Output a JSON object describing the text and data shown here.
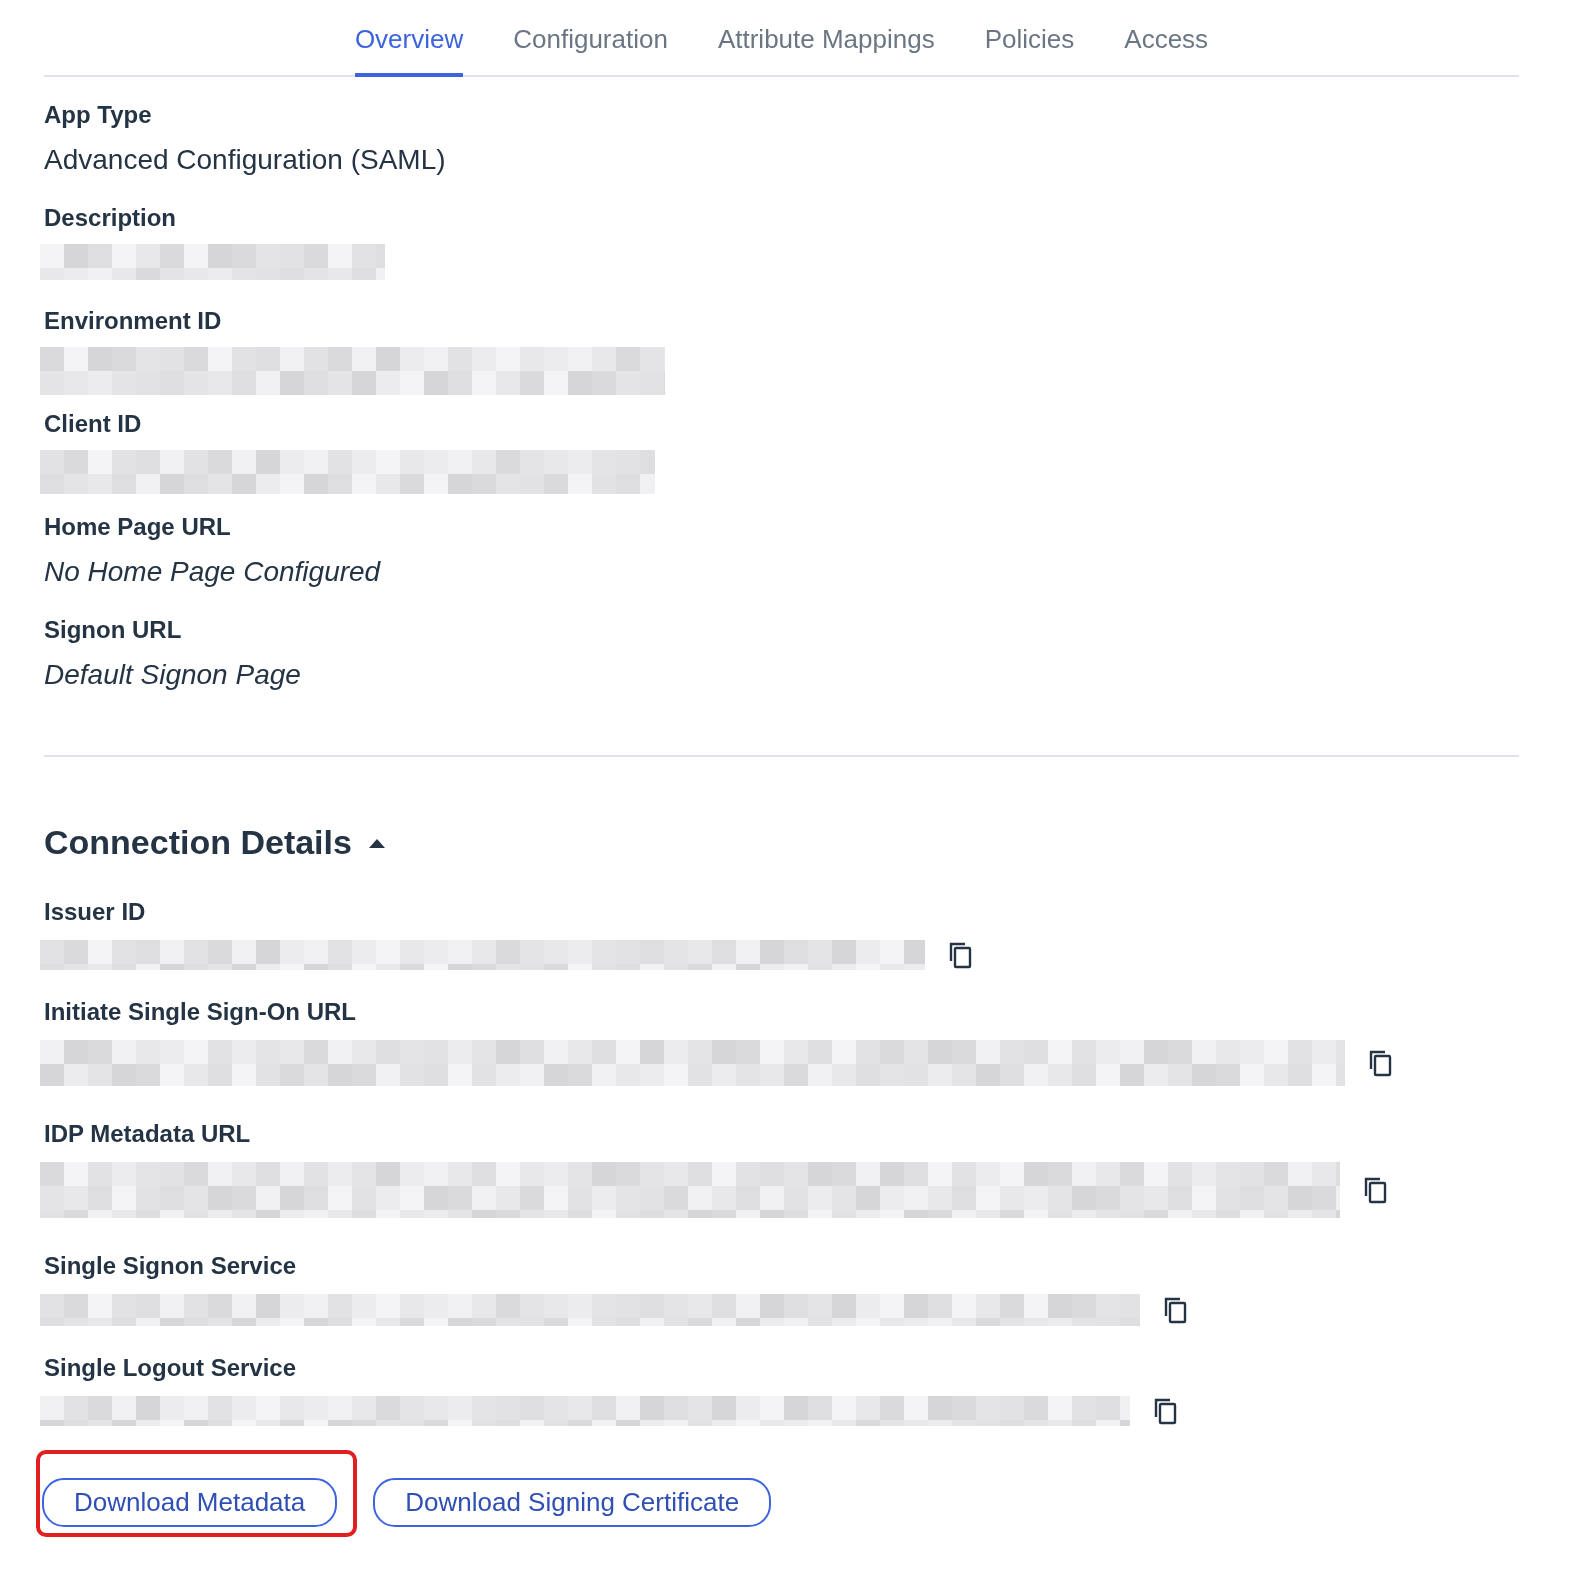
{
  "tabs": [
    {
      "label": "Overview",
      "selected": true
    },
    {
      "label": "Configuration",
      "selected": false
    },
    {
      "label": "Attribute Mappings",
      "selected": false
    },
    {
      "label": "Policies",
      "selected": false
    },
    {
      "label": "Access",
      "selected": false
    }
  ],
  "app_fields": [
    {
      "label": "App Type",
      "kind": "value",
      "value": "Advanced Configuration (SAML)"
    },
    {
      "label": "Description",
      "kind": "redacted"
    },
    {
      "label": "Environment ID",
      "kind": "redacted"
    },
    {
      "label": "Client ID",
      "kind": "redacted"
    },
    {
      "label": "Home Page URL",
      "kind": "empty",
      "value": "No Home Page Configured"
    },
    {
      "label": "Signon URL",
      "kind": "empty",
      "value": "Default Signon Page"
    }
  ],
  "connection": {
    "title": "Connection Details",
    "expanded": true,
    "fields": [
      {
        "label": "Issuer ID",
        "kind": "redacted"
      },
      {
        "label": "Initiate Single Sign-On URL",
        "kind": "redacted"
      },
      {
        "label": "IDP Metadata URL",
        "kind": "redacted"
      },
      {
        "label": "Single Signon Service",
        "kind": "redacted"
      },
      {
        "label": "Single Logout Service",
        "kind": "redacted"
      }
    ]
  },
  "buttons": [
    {
      "label": "Download Metadata",
      "highlighted": true
    },
    {
      "label": "Download Signing Certificate",
      "highlighted": false
    }
  ]
}
